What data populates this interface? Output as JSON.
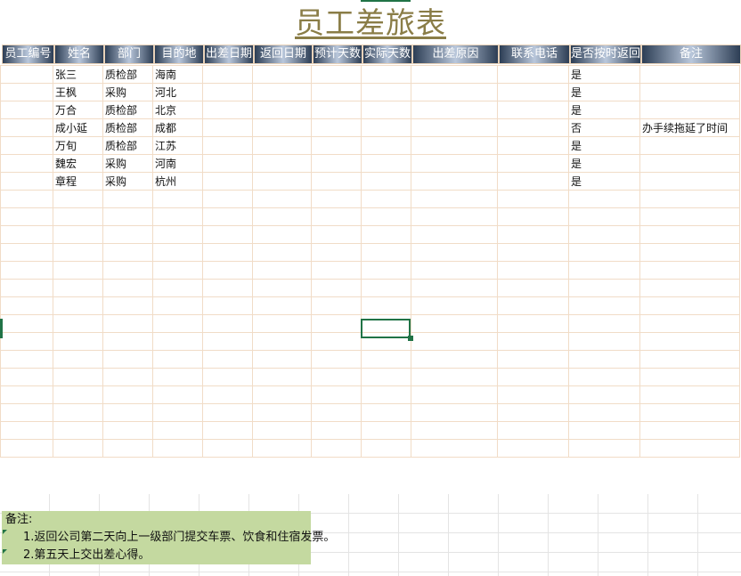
{
  "title": "员工差旅表",
  "headers": [
    "员工编号",
    "姓名",
    "部门",
    "目的地",
    "出差日期",
    "返回日期",
    "预计天数",
    "实际天数",
    "出差原因",
    "联系电话",
    "是否按时返回",
    "备注"
  ],
  "rows": [
    [
      "",
      "张三",
      "质检部",
      "海南",
      "",
      "",
      "",
      "",
      "",
      "",
      "是",
      ""
    ],
    [
      "",
      "王枫",
      "采购",
      "河北",
      "",
      "",
      "",
      "",
      "",
      "",
      "是",
      ""
    ],
    [
      "",
      "万合",
      "质检部",
      "北京",
      "",
      "",
      "",
      "",
      "",
      "",
      "是",
      ""
    ],
    [
      "",
      "成小延",
      "质检部",
      "成都",
      "",
      "",
      "",
      "",
      "",
      "",
      "否",
      "办手续拖延了时间"
    ],
    [
      "",
      "万旬",
      "质检部",
      "江苏",
      "",
      "",
      "",
      "",
      "",
      "",
      "是",
      ""
    ],
    [
      "",
      "魏宏",
      "采购",
      "河南",
      "",
      "",
      "",
      "",
      "",
      "",
      "是",
      ""
    ],
    [
      "",
      "章程",
      "采购",
      "杭州",
      "",
      "",
      "",
      "",
      "",
      "",
      "是",
      ""
    ]
  ],
  "empty_rows": 15,
  "note": {
    "heading": "备注:",
    "lines": [
      "1.返回公司第二天向上一级部门提交车票、饮食和住宿发票。",
      "2.第五天上交出差心得。"
    ]
  }
}
